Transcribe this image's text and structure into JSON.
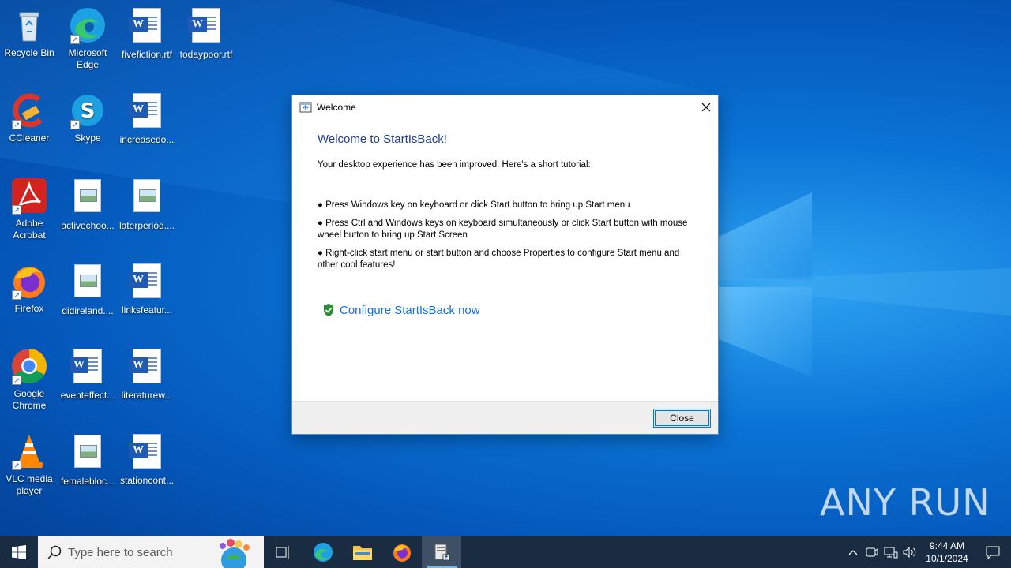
{
  "desktop": {
    "icons": [
      {
        "label": "Recycle Bin"
      },
      {
        "label": "Microsoft Edge"
      },
      {
        "label": "fivefiction.rtf"
      },
      {
        "label": "todaypoor.rtf"
      },
      {
        "label": "CCleaner"
      },
      {
        "label": "Skype"
      },
      {
        "label": "increasedo..."
      },
      {
        "label": "Adobe Acrobat"
      },
      {
        "label": "activechoo..."
      },
      {
        "label": "laterperiod...."
      },
      {
        "label": "Firefox"
      },
      {
        "label": "didireland...."
      },
      {
        "label": "linksfeatur..."
      },
      {
        "label": "Google Chrome"
      },
      {
        "label": "eventeffect..."
      },
      {
        "label": "literaturew..."
      },
      {
        "label": "VLC media player"
      },
      {
        "label": "femalebloc..."
      },
      {
        "label": "stationcont..."
      }
    ]
  },
  "dialog": {
    "title": "Welcome",
    "heading": "Welcome to StartIsBack!",
    "intro": "Your desktop experience has been improved. Here's a short tutorial:",
    "bullets": [
      "● Press Windows key on keyboard or click Start button to bring up Start menu",
      "● Press Ctrl and Windows keys on keyboard simultaneously or click Start button with mouse wheel button to bring up Start Screen",
      "● Right-click start menu or start button and choose Properties to configure Start menu and other cool features!"
    ],
    "configure_link": "Configure StartIsBack now",
    "close_button": "Close"
  },
  "watermark": {
    "text": "ANY RUN"
  },
  "taskbar": {
    "search_placeholder": "Type here to search",
    "time": "9:44 AM",
    "date": "10/1/2024"
  },
  "colors": {
    "accent": "#0078d7",
    "heading": "#1c3f95",
    "link": "#1a6fd6",
    "taskbar": "#1a2c42"
  }
}
